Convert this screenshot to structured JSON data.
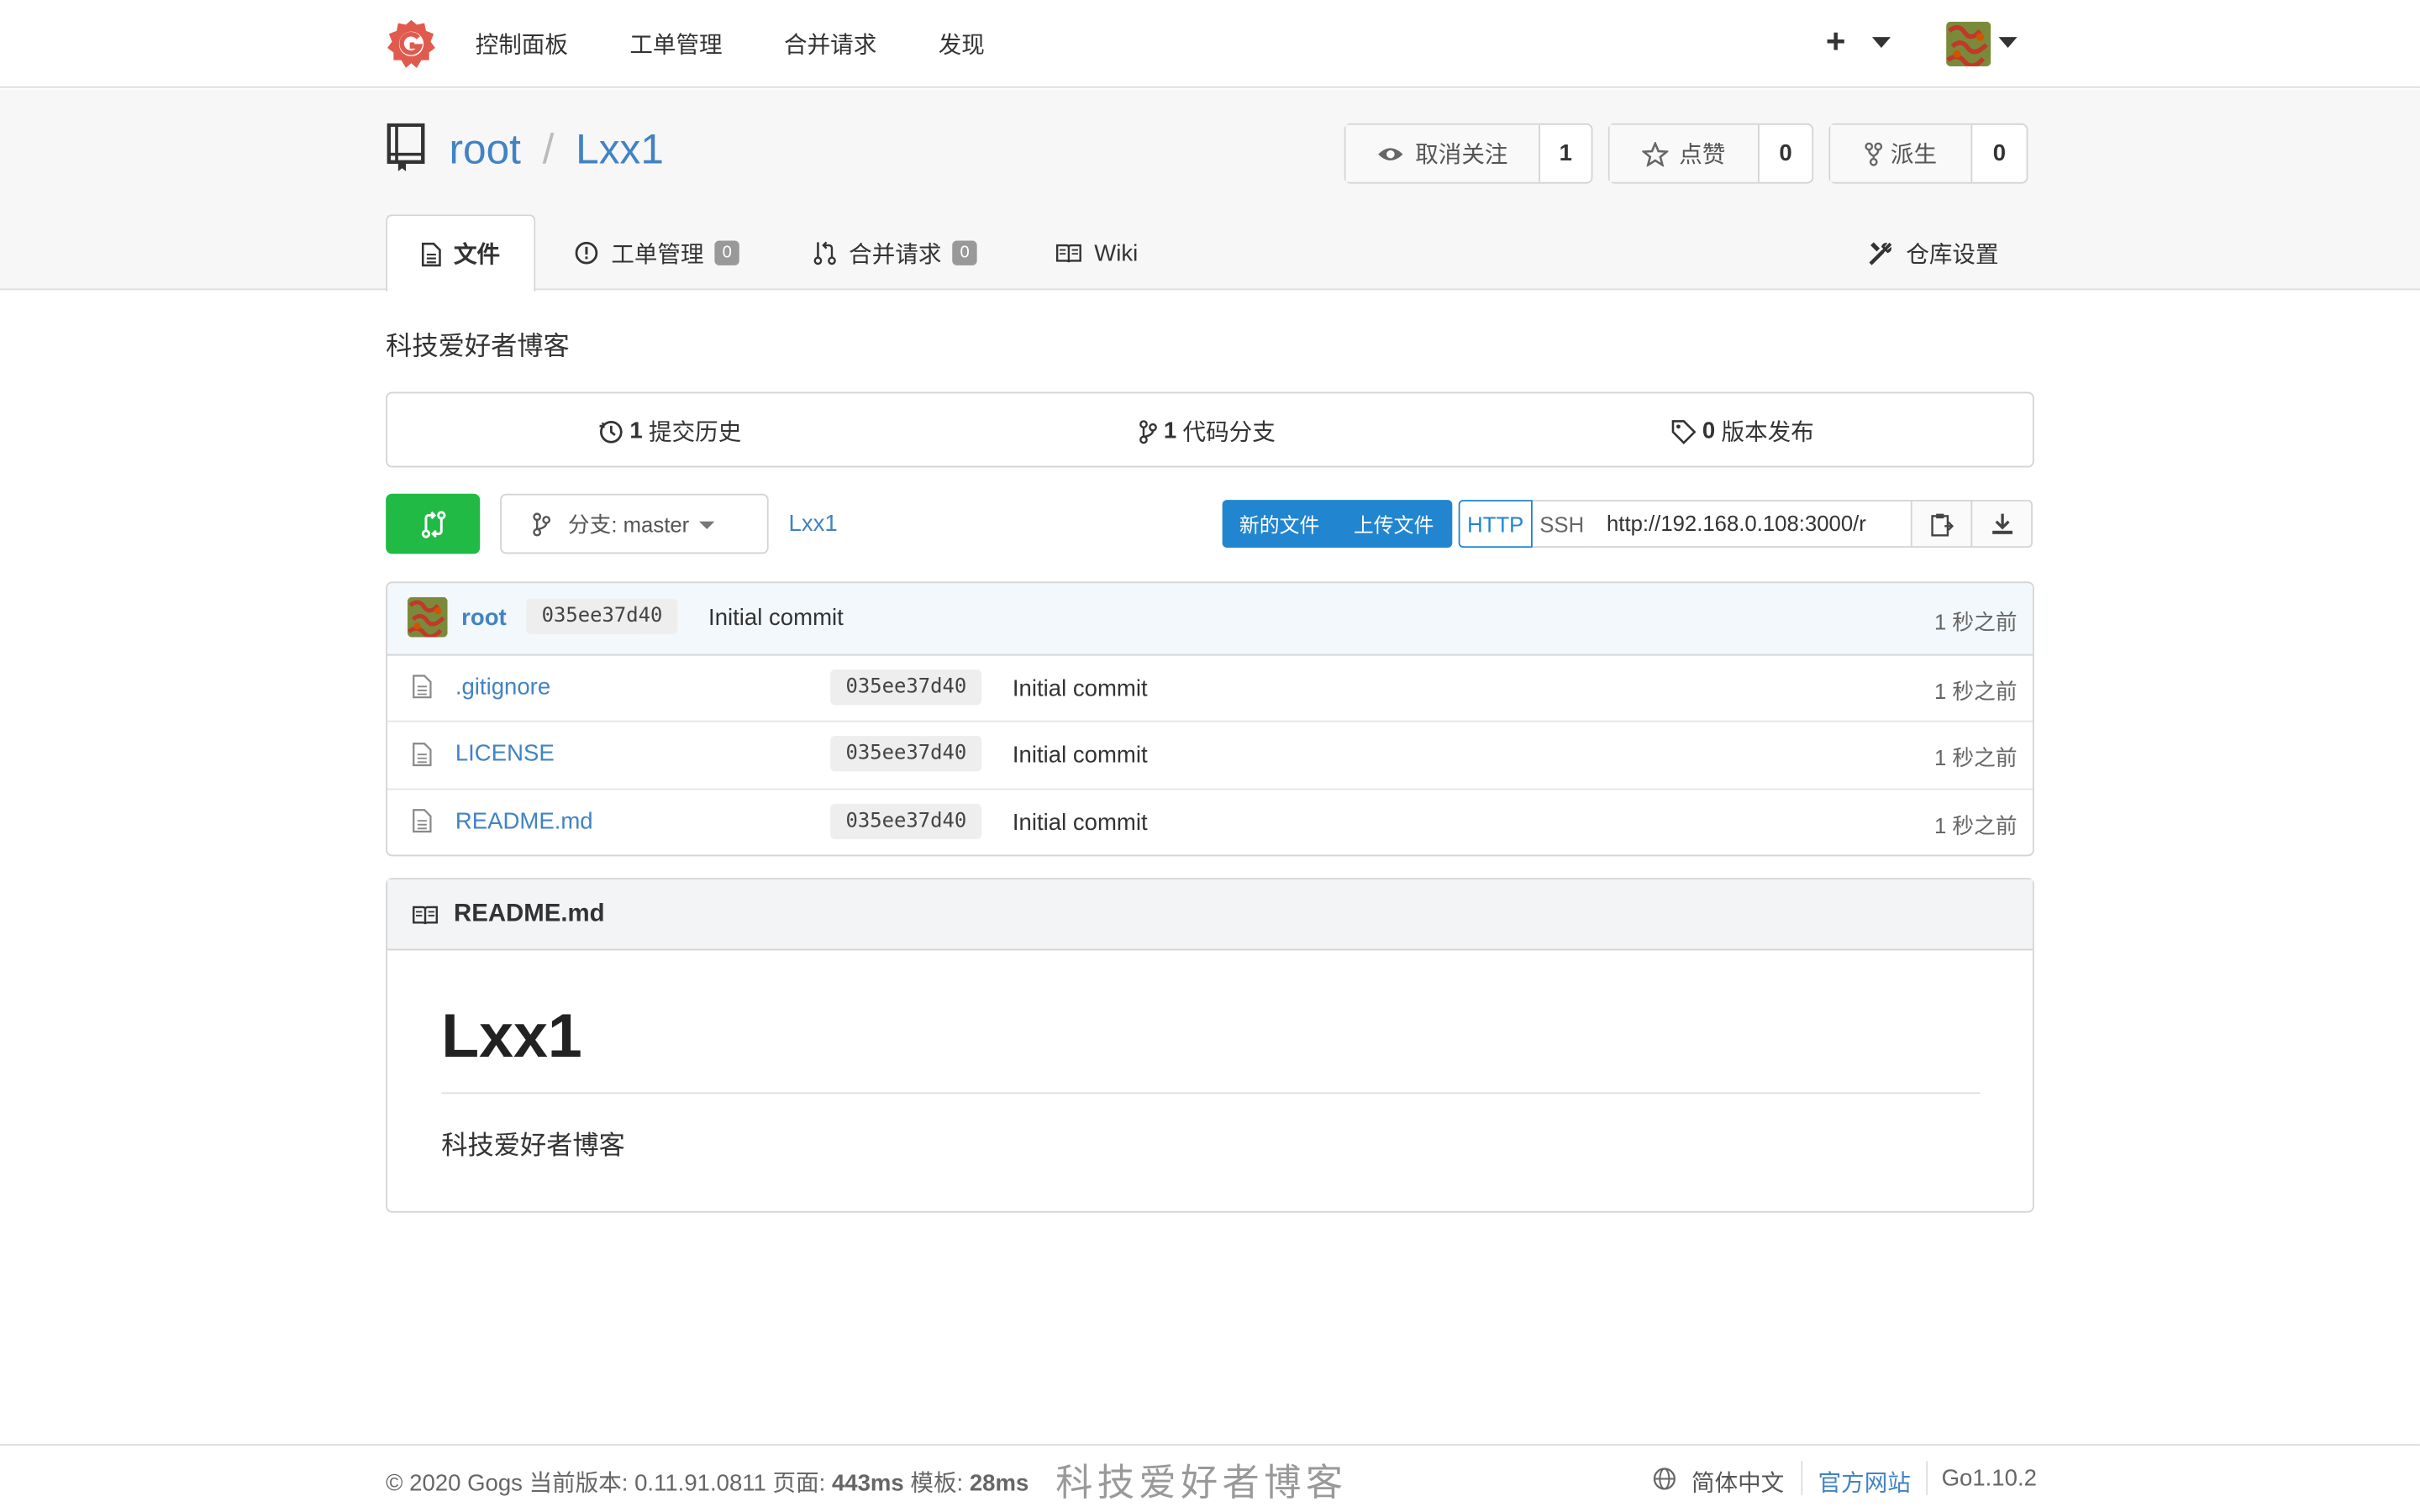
{
  "topnav": {
    "items": [
      "控制面板",
      "工单管理",
      "合并请求",
      "发现"
    ],
    "plus": "+"
  },
  "repo": {
    "owner": "root",
    "separator": "/",
    "name": "Lxx1",
    "watch": {
      "label": "取消关注",
      "count": "1"
    },
    "star": {
      "label": "点赞",
      "count": "0"
    },
    "fork": {
      "label": "派生",
      "count": "0"
    }
  },
  "tabs": {
    "files": "文件",
    "issues": "工单管理",
    "issues_count": "0",
    "pulls": "合并请求",
    "pulls_count": "0",
    "wiki": "Wiki",
    "settings": "仓库设置"
  },
  "description": "科技爱好者博客",
  "stats": {
    "commits_num": "1",
    "commits_label": "提交历史",
    "branches_num": "1",
    "branches_label": "代码分支",
    "releases_num": "0",
    "releases_label": "版本发布"
  },
  "toolbar": {
    "branch_prefix": "分支:",
    "branch": "master",
    "breadcrumb": "Lxx1",
    "new_file": "新的文件",
    "upload_file": "上传文件",
    "http": "HTTP",
    "ssh": "SSH",
    "clone_url": "http://192.168.0.108:3000/r"
  },
  "latest_commit": {
    "author": "root",
    "sha": "035ee37d40",
    "message": "Initial commit",
    "time": "1 秒之前"
  },
  "files": [
    {
      "name": ".gitignore",
      "sha": "035ee37d40",
      "message": "Initial commit",
      "time": "1 秒之前"
    },
    {
      "name": "LICENSE",
      "sha": "035ee37d40",
      "message": "Initial commit",
      "time": "1 秒之前"
    },
    {
      "name": "README.md",
      "sha": "035ee37d40",
      "message": "Initial commit",
      "time": "1 秒之前"
    }
  ],
  "readme": {
    "filename": "README.md",
    "h1": "Lxx1",
    "paragraph": "科技爱好者博客"
  },
  "footer": {
    "copyright": "© 2020 Gogs 当前版本: 0.11.91.0811 页面: ",
    "page_time": "443ms",
    "tmpl_label": " 模板: ",
    "tmpl_time": "28ms",
    "watermark": "科技爱好者博客",
    "language": "简体中文",
    "website": "官方网站",
    "go_version": "Go1.10.2"
  },
  "colors": {
    "link": "#4183c4",
    "green": "#21ba45",
    "blue": "#2185d0",
    "logo": "#e05a4d"
  }
}
